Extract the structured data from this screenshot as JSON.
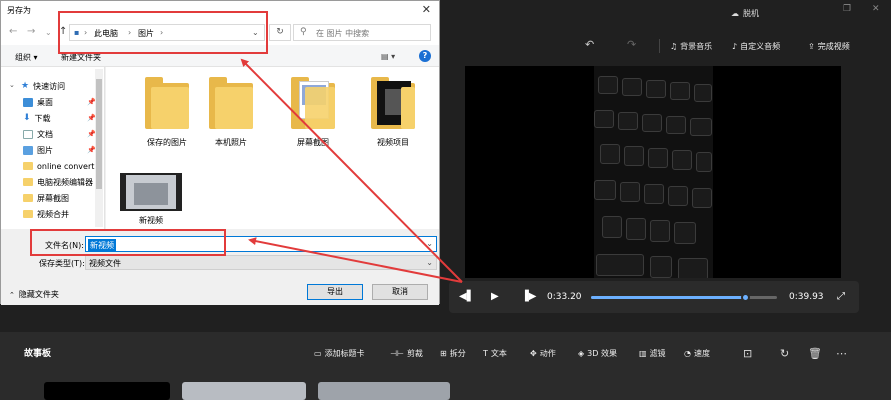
{
  "dialog": {
    "title": "另存为",
    "breadcrumb": [
      "此电脑",
      "图片"
    ],
    "search_placeholder": "在 图片 中搜索",
    "organize_label": "组织",
    "new_folder_label": "新建文件夹",
    "nav_items": [
      {
        "label": "快速访问",
        "icon": "star-icon"
      },
      {
        "label": "桌面",
        "icon": "desktop-icon",
        "pinned": true
      },
      {
        "label": "下载",
        "icon": "download-icon",
        "pinned": true
      },
      {
        "label": "文档",
        "icon": "document-icon",
        "pinned": true
      },
      {
        "label": "图片",
        "icon": "picture-icon",
        "pinned": true
      },
      {
        "label": "online convert",
        "icon": "folder-icon"
      },
      {
        "label": "电脑视频编辑器",
        "icon": "folder-icon"
      },
      {
        "label": "屏幕截图",
        "icon": "folder-icon"
      },
      {
        "label": "视频合并",
        "icon": "folder-icon"
      }
    ],
    "files": [
      {
        "label": "保存的图片",
        "type": "folder"
      },
      {
        "label": "本机照片",
        "type": "folder"
      },
      {
        "label": "屏幕截图",
        "type": "folder-preview"
      },
      {
        "label": "视频项目",
        "type": "folder-preview"
      },
      {
        "label": "新视频",
        "type": "video"
      }
    ],
    "filename_label": "文件名(N):",
    "filename_value": "新视频",
    "filetype_label": "保存类型(T):",
    "filetype_value": "视频文件",
    "hide_folders_label": "隐藏文件夹",
    "export_button": "导出",
    "cancel_button": "取消"
  },
  "editor": {
    "offline_label": "脱机",
    "background_music": "背景音乐",
    "custom_audio": "自定义音频",
    "finish_video": "完成视频",
    "current_time": "0:33.20",
    "total_time": "0:39.93",
    "progress": 0.831,
    "storyboard_title": "故事板",
    "storyboard_tools": [
      "添加标题卡",
      "剪裁",
      "拆分",
      "文本",
      "动作",
      "3D 效果",
      "滤镜",
      "速度"
    ]
  },
  "colors": {
    "accent": "#0078d7",
    "annotation": "#e23b3b",
    "progress": "#6cb0ff"
  }
}
